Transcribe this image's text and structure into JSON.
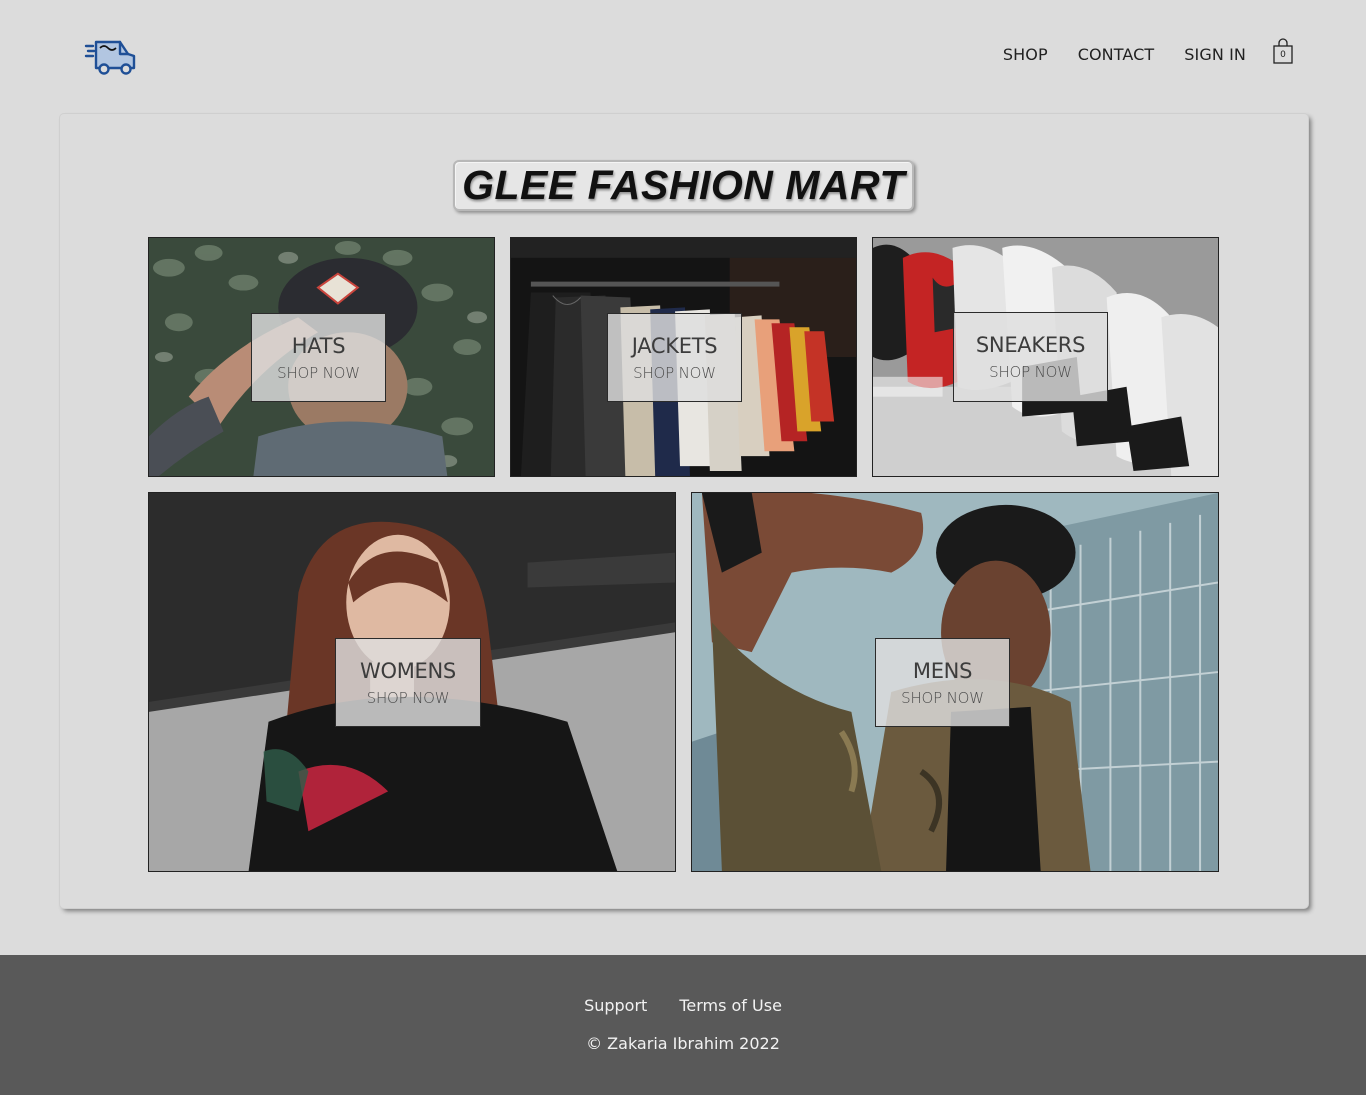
{
  "header": {
    "logo_icon": "delivery-van-icon",
    "nav": [
      {
        "label": "SHOP"
      },
      {
        "label": "CONTACT"
      },
      {
        "label": "SIGN IN"
      }
    ],
    "cart": {
      "icon": "shopping-bag-icon",
      "count": "0"
    }
  },
  "main": {
    "title": "GLEE FASHION MART",
    "categories": [
      {
        "title": "HATS",
        "cta": "SHOP NOW"
      },
      {
        "title": "JACKETS",
        "cta": "SHOP NOW"
      },
      {
        "title": "SNEAKERS",
        "cta": "SHOP NOW"
      },
      {
        "title": "WOMENS",
        "cta": "SHOP NOW"
      },
      {
        "title": "MENS",
        "cta": "SHOP NOW"
      }
    ]
  },
  "footer": {
    "links": [
      {
        "label": "Support"
      },
      {
        "label": "Terms of Use"
      }
    ],
    "copyright": "© Zakaria Ibrahim 2022"
  },
  "colors": {
    "page_bg": "#dcdcdc",
    "footer_bg": "#595959",
    "logo_blue": "#2a66b8"
  }
}
